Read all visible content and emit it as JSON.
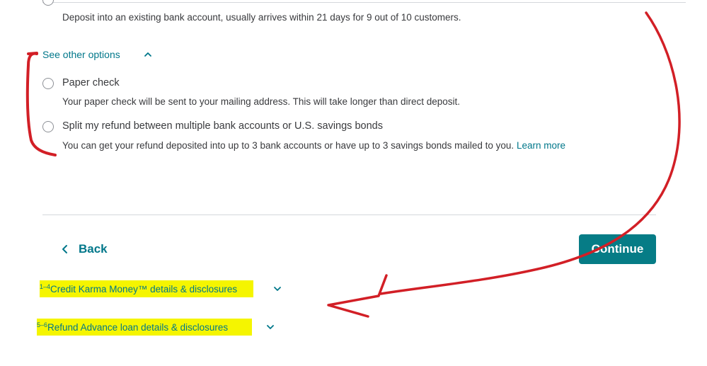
{
  "direct_deposit": {
    "description": "Deposit into an existing bank account, usually arrives within 21 days for 9 out of 10 customers."
  },
  "see_other_options": {
    "label": "See other options"
  },
  "options": [
    {
      "label": "Paper check",
      "description": "Your paper check will be sent to your mailing address. This will take longer than direct deposit."
    },
    {
      "label": "Split my refund between multiple bank accounts or U.S. savings bonds",
      "description": "You can get your refund deposited into up to 3 bank accounts or have up to 3 savings bonds mailed to you.",
      "link": "Learn more"
    }
  ],
  "nav": {
    "back_label": "Back",
    "continue_label": "Continue"
  },
  "disclosures": [
    {
      "sup": "1–4",
      "label": "Credit Karma Money™ details & disclosures"
    },
    {
      "sup": "5–6",
      "label": "Refund Advance loan details & disclosures"
    }
  ],
  "colors": {
    "link": "#00778a",
    "primary_button": "#067c86",
    "highlight": "#f5f500",
    "annotation": "#d21f26"
  }
}
